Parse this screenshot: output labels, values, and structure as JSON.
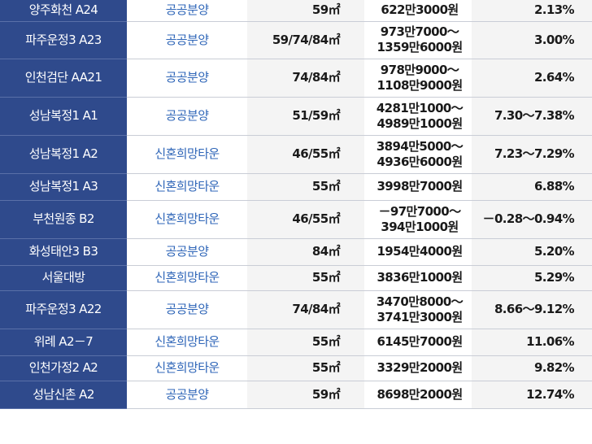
{
  "rows": [
    {
      "name": "양주화천 A24",
      "type": "공공분양",
      "area": "59㎡",
      "price": [
        "622만3000원"
      ],
      "rate": "2.13%"
    },
    {
      "name": "파주운정3 A23",
      "type": "공공분양",
      "area": "59/74/84㎡",
      "price": [
        "973만7000～",
        "1359만6000원"
      ],
      "rate": "3.00%"
    },
    {
      "name": "인천검단 AA21",
      "type": "공공분양",
      "area": "74/84㎡",
      "price": [
        "978만9000～",
        "1108만9000원"
      ],
      "rate": "2.64%"
    },
    {
      "name": "성남복정1 A1",
      "type": "공공분양",
      "area": "51/59㎡",
      "price": [
        "4281만1000～",
        "4989만1000원"
      ],
      "rate": "7.30～7.38%"
    },
    {
      "name": "성남복정1 A2",
      "type": "신혼희망타운",
      "area": "46/55㎡",
      "price": [
        "3894만5000～",
        "4936만6000원"
      ],
      "rate": "7.23～7.29%"
    },
    {
      "name": "성남복정1 A3",
      "type": "신혼희망타운",
      "area": "55㎡",
      "price": [
        "3998만7000원"
      ],
      "rate": "6.88%"
    },
    {
      "name": "부천원종 B2",
      "type": "신혼희망타운",
      "area": "46/55㎡",
      "price": [
        "－97만7000～",
        "394만1000원"
      ],
      "rate": "－0.28～0.94%"
    },
    {
      "name": "화성태안3 B3",
      "type": "공공분양",
      "area": "84㎡",
      "price": [
        "1954만4000원"
      ],
      "rate": "5.20%"
    },
    {
      "name": "서울대방",
      "type": "신혼희망타운",
      "area": "55㎡",
      "price": [
        "3836만1000원"
      ],
      "rate": "5.29%"
    },
    {
      "name": "파주운정3 A22",
      "type": "공공분양",
      "area": "74/84㎡",
      "price": [
        "3470만8000～",
        "3741만3000원"
      ],
      "rate": "8.66～9.12%"
    },
    {
      "name": "위례 A2－7",
      "type": "신혼희망타운",
      "area": "55㎡",
      "price": [
        "6145만7000원"
      ],
      "rate": "11.06%"
    },
    {
      "name": "인천가정2 A2",
      "type": "신혼희망타운",
      "area": "55㎡",
      "price": [
        "3329만2000원"
      ],
      "rate": "9.82%"
    },
    {
      "name": "성남신촌 A2",
      "type": "공공분양",
      "area": "59㎡",
      "price": [
        "8698만2000원"
      ],
      "rate": "12.74%"
    }
  ]
}
